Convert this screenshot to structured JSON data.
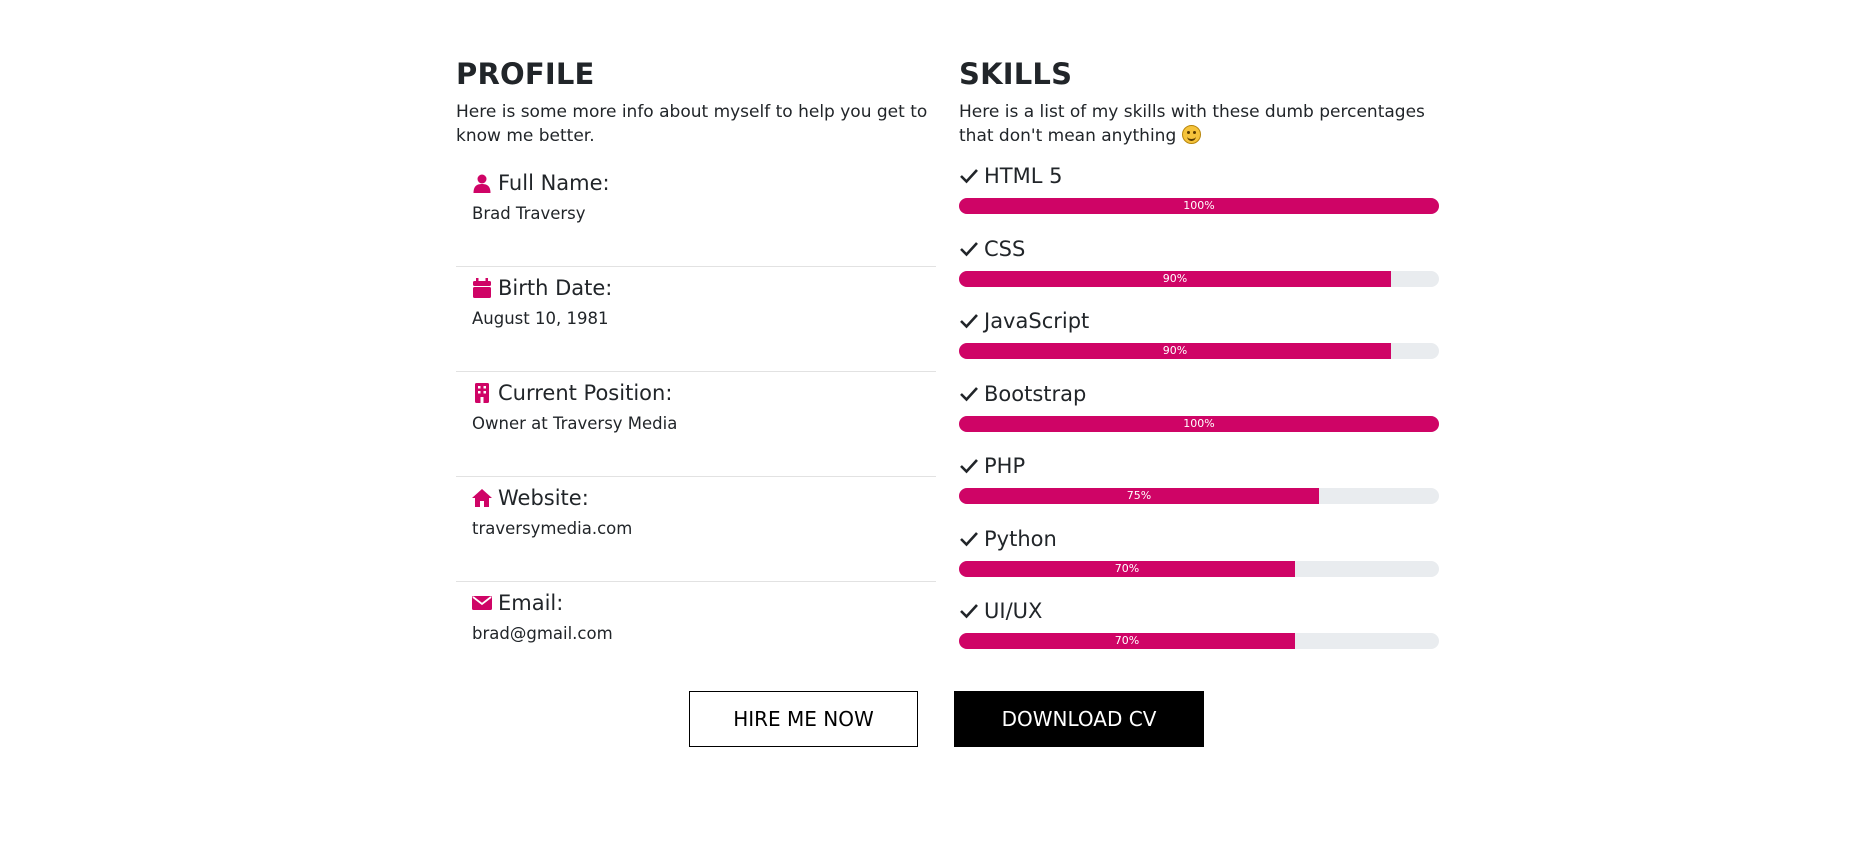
{
  "profile": {
    "title": "PROFILE",
    "intro": "Here is some more info about myself to help you get to know me better.",
    "items": [
      {
        "icon": "user-icon",
        "label": "Full Name:",
        "value": "Brad Traversy"
      },
      {
        "icon": "calendar-icon",
        "label": "Birth Date:",
        "value": "August 10, 1981"
      },
      {
        "icon": "building-icon",
        "label": "Current Position:",
        "value": "Owner at Traversy Media"
      },
      {
        "icon": "home-icon",
        "label": "Website:",
        "value": "traversymedia.com"
      },
      {
        "icon": "envelope-icon",
        "label": "Email:",
        "value": "brad@gmail.com"
      }
    ]
  },
  "skills": {
    "title": "SKILLS",
    "intro": "Here is a list of my skills with these dumb percentages that don't mean anything",
    "items": [
      {
        "name": "HTML 5",
        "percent": 100,
        "label": "100%"
      },
      {
        "name": "CSS",
        "percent": 90,
        "label": "90%"
      },
      {
        "name": "JavaScript",
        "percent": 90,
        "label": "90%"
      },
      {
        "name": "Bootstrap",
        "percent": 100,
        "label": "100%"
      },
      {
        "name": "PHP",
        "percent": 75,
        "label": "75%"
      },
      {
        "name": "Python",
        "percent": 70,
        "label": "70%"
      },
      {
        "name": "UI/UX",
        "percent": 70,
        "label": "70%"
      }
    ]
  },
  "buttons": {
    "hire_label": "HIRE ME NOW",
    "download_label": "DOWNLOAD CV"
  },
  "colors": {
    "accent": "#cf0466",
    "bar_track": "#e9ecef",
    "text": "#212529"
  }
}
